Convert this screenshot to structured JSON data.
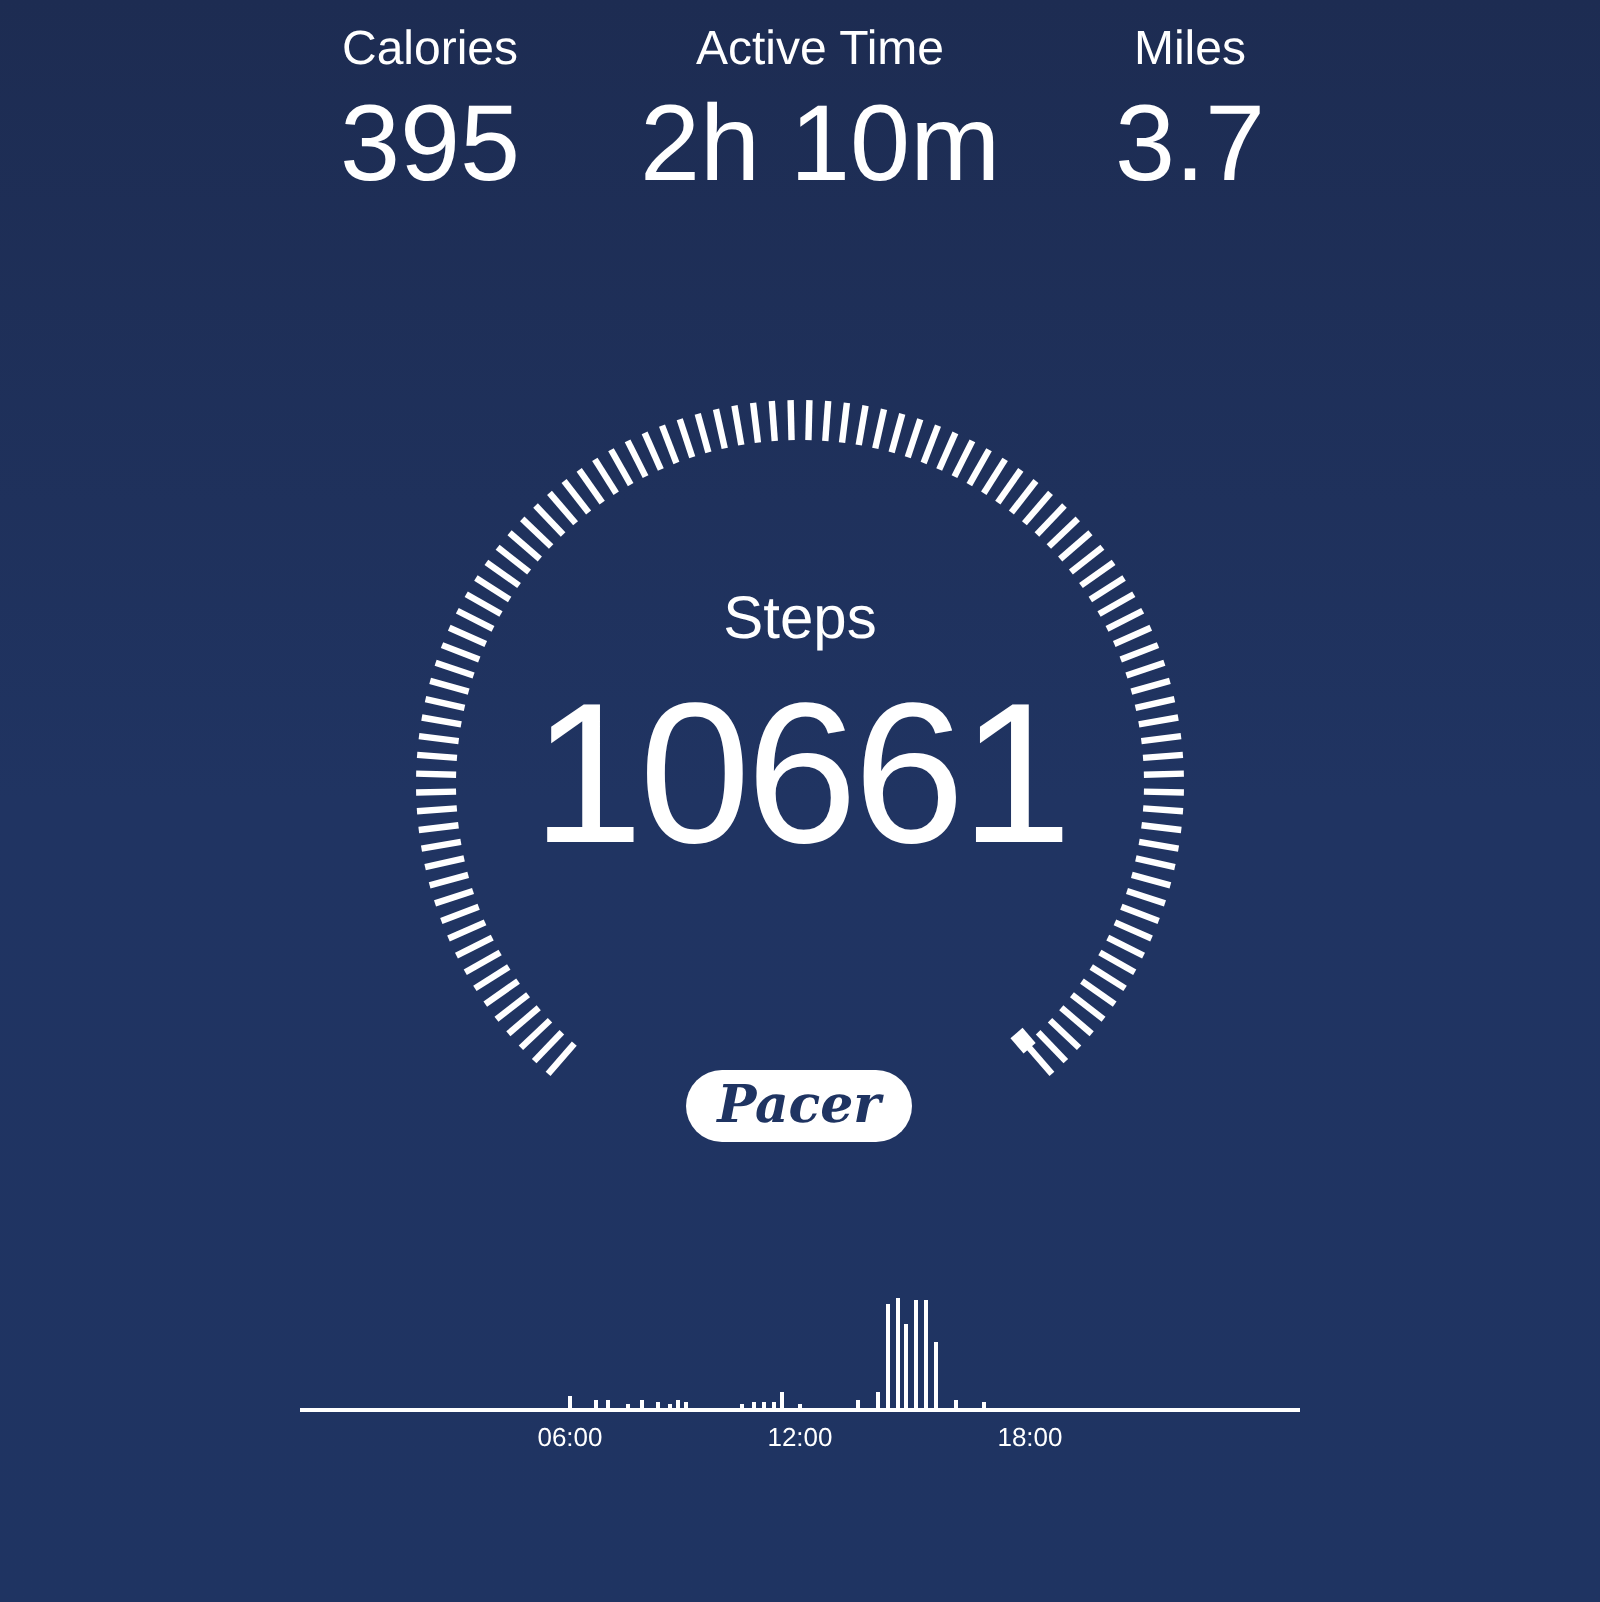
{
  "stats": [
    {
      "label": "Calories",
      "value": "395"
    },
    {
      "label": "Active Time",
      "value": "2h 10m"
    },
    {
      "label": "Miles",
      "value": "3.7"
    }
  ],
  "gauge": {
    "label": "Steps",
    "value": "10661"
  },
  "badge": "Pacer",
  "timeline": {
    "labels": [
      "06:00",
      "12:00",
      "18:00"
    ]
  }
}
